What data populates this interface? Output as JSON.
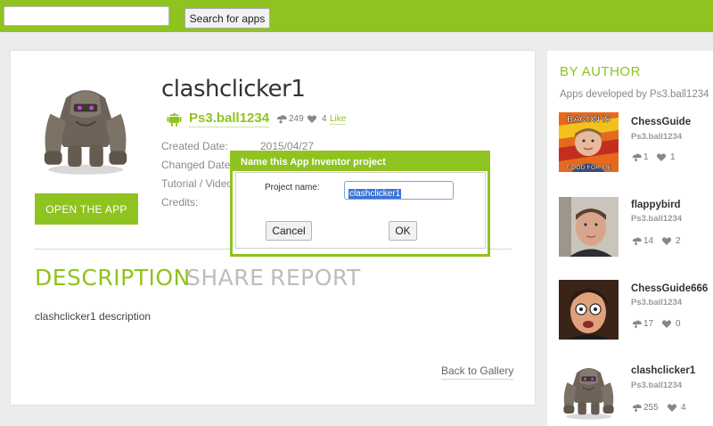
{
  "topbar": {
    "search_placeholder": "",
    "search_button": "Search for apps"
  },
  "app": {
    "title": "clashclicker1",
    "author": "Ps3.ball1234",
    "downloads": "249",
    "likes": "4",
    "like_label": "Like",
    "meta": [
      {
        "label": "Created Date:",
        "value": "2015/04/27"
      },
      {
        "label": "Changed Date:",
        "value": ""
      },
      {
        "label": "Tutorial / Video:",
        "value": ""
      },
      {
        "label": "Credits:",
        "value": ""
      }
    ],
    "open_button": "OPEN THE APP"
  },
  "tabs": {
    "description": "DESCRIPTION",
    "share": "SHARE",
    "report": "REPORT"
  },
  "description_text": "clashclicker1 description",
  "back_link": "Back to Gallery",
  "sidebar": {
    "title": "BY AUTHOR",
    "subtitle": "Apps developed by Ps3.ball1234",
    "apps": [
      {
        "name": "ChessGuide",
        "author": "Ps3.ball1234",
        "downloads": "1",
        "likes": "1",
        "thumb_top": "BACON IS",
        "thumb_bottom": "GOOD FOR ME"
      },
      {
        "name": "flappybird",
        "author": "Ps3.ball1234",
        "downloads": "14",
        "likes": "2"
      },
      {
        "name": "ChessGuide666",
        "author": "Ps3.ball1234",
        "downloads": "17",
        "likes": "0"
      },
      {
        "name": "clashclicker1",
        "author": "Ps3.ball1234",
        "downloads": "255",
        "likes": "4"
      }
    ]
  },
  "dialog": {
    "title": "Name this App Inventor project",
    "label": "Project name:",
    "value": "clashclicker1",
    "cancel": "Cancel",
    "ok": "OK"
  },
  "colors": {
    "accent": "#8fc31f",
    "selection": "#3a73d7"
  }
}
